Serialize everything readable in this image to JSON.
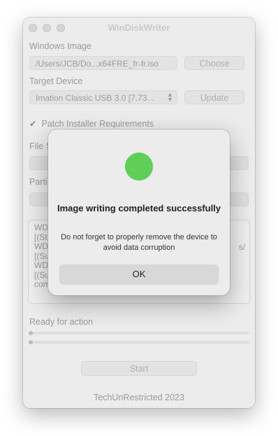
{
  "window": {
    "title": "WinDiskWriter"
  },
  "windows_image": {
    "label": "Windows Image",
    "path": "/Users/JCB/Do...x64FRE_fr-fr.iso",
    "choose_label": "Choose"
  },
  "target_device": {
    "label": "Target Device",
    "selected": "Imation Classic USB 3.0 [7.73...",
    "chevron": "⌃⌄",
    "update_label": "Update"
  },
  "options": {
    "patch_label": "Patch Installer Requirements",
    "patch_checked": true,
    "file_system_label": "File S",
    "partition_label": "Parti"
  },
  "log": {
    "lines": [
      "WD",
      "[(St",
      "WD",
      "[(Su",
      "WD",
      "[(Su",
      "com"
    ],
    "visible_fragment": "s/"
  },
  "status": {
    "text": "Ready for action"
  },
  "start_label": "Start",
  "footer": "TechUnRestricted 2023",
  "dialog": {
    "icon": "success-circle",
    "icon_color": "#5fcf5a",
    "title": "Image writing completed successfully",
    "message": "Do not forget to properly remove the device to avoid data corruption",
    "ok_label": "OK"
  }
}
